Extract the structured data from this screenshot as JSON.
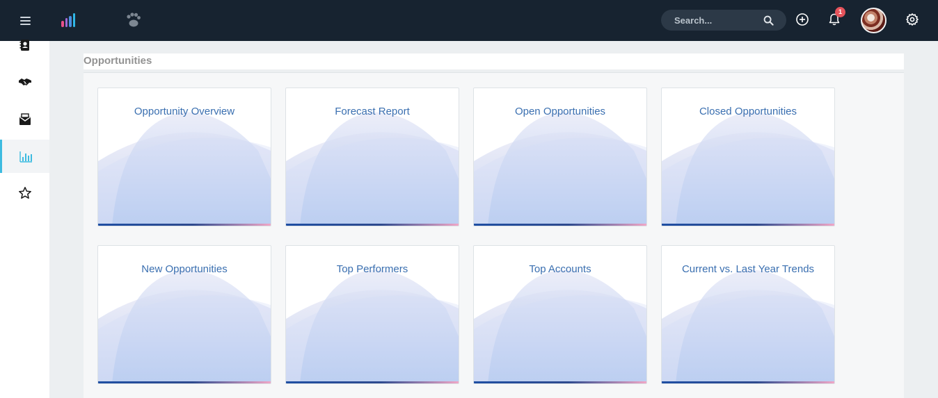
{
  "header": {
    "search_placeholder": "Search...",
    "notification_count": "1",
    "icons": [
      "hamburger-menu-icon",
      "app-logo",
      "paw-icon",
      "search-icon",
      "add-icon",
      "bell-icon",
      "avatar",
      "gear-icon"
    ]
  },
  "sidebar": {
    "items": [
      {
        "icon": "contact-book-icon",
        "active": false
      },
      {
        "icon": "handshake-icon",
        "active": false
      },
      {
        "icon": "envelope-icon",
        "active": false
      },
      {
        "icon": "reports-chart-icon",
        "active": true
      },
      {
        "icon": "star-icon",
        "active": false
      }
    ]
  },
  "main": {
    "title": "Opportunities",
    "cards": [
      {
        "title": "Opportunity Overview"
      },
      {
        "title": "Forecast Report"
      },
      {
        "title": "Open Opportunities"
      },
      {
        "title": "Closed Opportunities"
      },
      {
        "title": "New Opportunities"
      },
      {
        "title": "Top Performers"
      },
      {
        "title": "Top Accounts"
      },
      {
        "title": "Current vs. Last Year Trends"
      }
    ]
  },
  "colors": {
    "topbar": "#172330",
    "accent": "#3dbbe0",
    "card_title": "#3a6fb0",
    "badge": "#e5535b"
  }
}
